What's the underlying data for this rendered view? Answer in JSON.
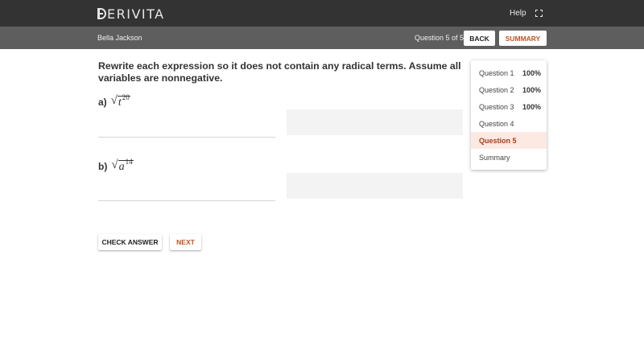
{
  "app": {
    "brand": "DERIVITA",
    "brand_text": "ERIVITA"
  },
  "header": {
    "help_label": "Help",
    "fullscreen_icon": "fullscreen-icon"
  },
  "subheader": {
    "user_name": "Bella Jackson",
    "question_counter": "Question 5 of 5",
    "back_label": "BACK",
    "summary_label": "SUMMARY"
  },
  "question": {
    "prompt": "Rewrite each expression so it does not contain any radical terms. Assume all variables are nonnegative.",
    "parts": [
      {
        "label": "a)",
        "variable": "t",
        "exponent": "20",
        "answer_value": ""
      },
      {
        "label": "b)",
        "variable": "a",
        "exponent": "14",
        "answer_value": ""
      }
    ]
  },
  "actions": {
    "check_label": "CHECK ANSWER",
    "next_label": "NEXT"
  },
  "navigator": {
    "items": [
      {
        "label": "Question 1",
        "score": "100%"
      },
      {
        "label": "Question 2",
        "score": "100%"
      },
      {
        "label": "Question 3",
        "score": "100%"
      },
      {
        "label": "Question 4",
        "score": ""
      },
      {
        "label": "Question 5",
        "score": ""
      },
      {
        "label": "Summary",
        "score": ""
      }
    ],
    "active_index": 4
  },
  "colors": {
    "topbar": "#333333",
    "subbar": "#5e5e5e",
    "accent": "#c0531f",
    "active_bg": "#fce9e2"
  }
}
